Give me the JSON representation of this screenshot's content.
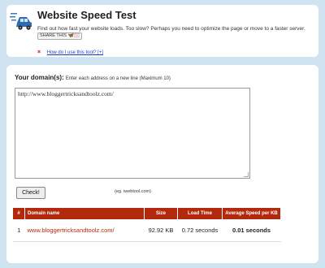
{
  "header": {
    "title": "Website Speed Test",
    "description": "Find out how fast your website loads. Too slow? Perhaps you need to optimize the page or move to a faster server.",
    "share_label": "SHARE THIS",
    "share_icons": "🦋🖂",
    "howto_link": "How do I use this tool? [+]",
    "bullet": "×"
  },
  "form": {
    "domains_label": "Your domain(s):",
    "domains_hint": "Enter each address on a new line (Maximum 10)",
    "textarea_value": "http://www.bloggertricksandtoolz.com/",
    "check_button": "Check!",
    "example": "(eg. iwebtool.com)"
  },
  "results": {
    "headers": [
      "#",
      "Domain name",
      "Size",
      "Load Time",
      "Average Speed per KB"
    ],
    "rows": [
      {
        "num": "1",
        "domain": "www.bloggertricksandtoolz.com/",
        "size": "92.92 KB",
        "load_time": "0.72 seconds",
        "avg_speed": "0.01 seconds"
      }
    ]
  },
  "colors": {
    "background": "#cfe3f0",
    "header_red": "#b3290e",
    "link_blue": "#1a3cc4"
  },
  "icons": [
    "car-speed-icon",
    "share-icon",
    "bullet-x-icon"
  ]
}
